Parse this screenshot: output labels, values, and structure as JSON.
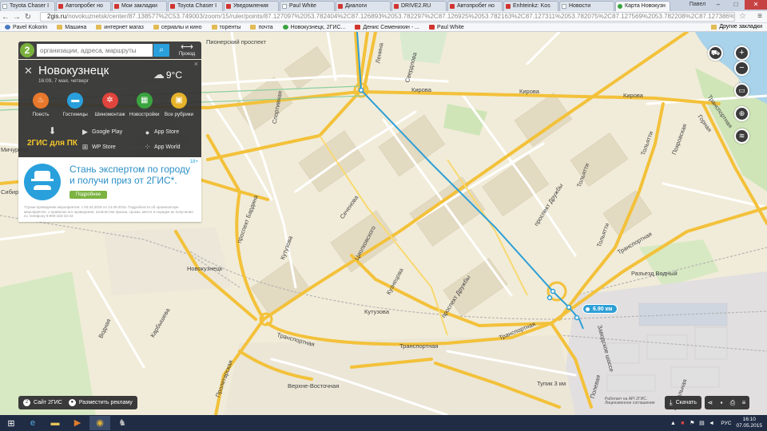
{
  "browser": {
    "tabs": [
      {
        "label": "Toyota Chaser I",
        "icon": "blank",
        "active": false
      },
      {
        "label": "Автопробег но",
        "icon": "red",
        "active": false
      },
      {
        "label": "Мои закладки",
        "icon": "red",
        "active": false
      },
      {
        "label": "Toyota Chaser I",
        "icon": "red",
        "active": false
      },
      {
        "label": "Уведомления",
        "icon": "red",
        "active": false
      },
      {
        "label": "Paul White",
        "icon": "blank",
        "active": false
      },
      {
        "label": "Диалоги",
        "icon": "red",
        "active": false
      },
      {
        "label": "DRIVE2.RU",
        "icon": "red",
        "active": false
      },
      {
        "label": "Автопробег но",
        "icon": "red",
        "active": false
      },
      {
        "label": "Enhteinkz: Kos",
        "icon": "red",
        "active": false
      },
      {
        "label": "Новости",
        "icon": "blank",
        "active": false
      },
      {
        "label": "Карта Новокузн",
        "icon": "green",
        "active": true
      }
    ],
    "window_user": "Павел",
    "url_host": "2gis.ru",
    "url_path": "/novokuznetsk/center/87.138577%2C53.749003/zoom/15/ruler/points/87.127097%2053.782404%2C87.126893%2053.782297%2C87.126925%2053.782163%2C87.127311%2053.782075%2C87.127569%2053.782208%2C87.127386%2053.78",
    "bookmarks": [
      {
        "label": "Pavel Kokorin",
        "icon": "person"
      },
      {
        "label": "Машина",
        "icon": "folder"
      },
      {
        "label": "интернет магаз",
        "icon": "folder"
      },
      {
        "label": "сериалы и кино",
        "icon": "folder"
      },
      {
        "label": "торенты",
        "icon": "folder"
      },
      {
        "label": "почта",
        "icon": "folder"
      },
      {
        "label": "Новокузнецк, 2ГИС...",
        "icon": "green"
      },
      {
        "label": "Денис Семенихин - ...",
        "icon": "red"
      },
      {
        "label": "Paul White",
        "icon": "red"
      }
    ],
    "other_bookmarks": "Другие закладки"
  },
  "search": {
    "placeholder": "организации, адреса, маршруты",
    "route_label": "Проезд"
  },
  "city": {
    "name": "Новокузнецк",
    "datetime": "16:09, 7 мая, четверг",
    "temperature": "9°C",
    "categories": [
      {
        "label": "Поесть",
        "color": "#e8782b",
        "icon": "fork-knife-icon",
        "glyph": "♨"
      },
      {
        "label": "Гостиницы",
        "color": "#29a0dc",
        "icon": "bed-icon",
        "glyph": "▬"
      },
      {
        "label": "Шиномонтаж",
        "color": "#e0443c",
        "icon": "tire-icon",
        "glyph": "✲"
      },
      {
        "label": "Новостройки",
        "color": "#3aa43f",
        "icon": "building-icon",
        "glyph": "▦"
      },
      {
        "label": "Все рубрики",
        "color": "#e5b22a",
        "icon": "briefcase-icon",
        "glyph": "▣"
      }
    ],
    "pc_label": "2ГИС для ПК",
    "stores": [
      {
        "label": "Google Play",
        "icon": "google-play-icon",
        "glyph": "▶"
      },
      {
        "label": "App Store",
        "icon": "apple-icon",
        "glyph": "●"
      },
      {
        "label": "WP Store",
        "icon": "windows-icon",
        "glyph": "⊞"
      },
      {
        "label": "App World",
        "icon": "blackberry-icon",
        "glyph": "⁘"
      }
    ]
  },
  "promo": {
    "age": "18+",
    "line1": "Стань экспертом по городу",
    "line2": "и получи приз от 2ГИС*.",
    "button": "Подробнее",
    "fine": "*Сроки проведения мероприятия: с 02.04.2015 по 14.09.2015. Подробности об организаторе мероприятия, о правилах его проведения, количестве призов, сроках, месте и порядке их получения по телефону 8-800-333-33-33"
  },
  "map": {
    "streets": {
      "kirova": "Кирова",
      "kirova2": "Кирова",
      "kirova3": "Кирова",
      "bardina": "проспект Бардина",
      "kutuzova_left": "Кутузова",
      "kutuzova": "Кутузова",
      "tsiolkovskogo": "Циолковского",
      "kuznetsova": "Кузнецова",
      "druzhby": "проспект Дружбы",
      "druzhby2": "проспект Дружбы",
      "transportnaya": "Транспортная",
      "transportnaya2": "Транспортная",
      "transportnaya3": "Транспортная",
      "transportnaya4": "Транспортная",
      "transportnaya_ne": "Транспортная",
      "tolyatti": "Тольятти",
      "tolyatti2": "Тольятти",
      "tolyatti3": "Тольятти",
      "seminova": "Сеченова",
      "pionersky": "Пионерский проспект",
      "sibirskaya": "Сибирская",
      "michurina": "Мичурина",
      "sporta": "Спортивная",
      "sverdlova": "Свердлова",
      "lenina": "Ленина",
      "razezd": "Разъезд Водный",
      "tupik": "Тупик 3 км",
      "verkhne": "Верхне-Восточная",
      "proletarskaya": "Пролетарская",
      "karbysheva": "Карбышева",
      "vodnaya": "Водная",
      "pokrovskaya": "Покровская",
      "zavodskoe": "Заводское шоссе",
      "gorny": "Горная",
      "volnaya": "Вокзальная",
      "novokuzn_st": "Новокузнецк",
      "polevaya": "Полевая"
    },
    "ruler_distance": "6.90 км"
  },
  "footer": {
    "site_label": "Сайт 2ГИС",
    "ad_label": "Разместить рекламу",
    "download_label": "Скачать",
    "copyright": "Работает на API 2ГИС. Лицензионное соглашение"
  },
  "taskbar": {
    "lang": "РУС",
    "time": "16:10",
    "date": "07.05.2015"
  }
}
